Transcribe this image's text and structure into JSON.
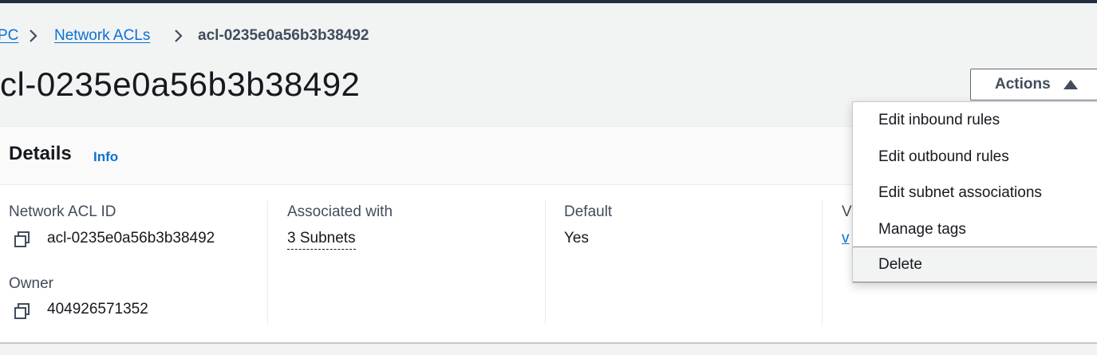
{
  "breadcrumb": {
    "vpc_label": "PC",
    "acls_label": "Network ACLs",
    "current": "acl-0235e0a56b3b38492"
  },
  "page": {
    "title": "cl-0235e0a56b3b38492"
  },
  "actions": {
    "label": "Actions"
  },
  "details": {
    "title": "Details",
    "info": "Info",
    "fields": {
      "acl_id": {
        "label": "Network ACL ID",
        "value": "acl-0235e0a56b3b38492"
      },
      "owner": {
        "label": "Owner",
        "value": "404926571352"
      },
      "associated": {
        "label": "Associated with",
        "value": "3 Subnets"
      },
      "default": {
        "label": "Default",
        "value": "Yes"
      },
      "vpc": {
        "label": "V",
        "value": "v"
      }
    }
  },
  "menu": {
    "items": [
      {
        "label": "Edit inbound rules"
      },
      {
        "label": "Edit outbound rules"
      },
      {
        "label": "Edit subnet associations"
      },
      {
        "label": "Manage tags"
      },
      {
        "label": "Delete"
      }
    ]
  },
  "icons": {
    "breadcrumb_separator": "chevron-right-icon",
    "copy": "copy-icon",
    "dropdown_open": "caret-up-icon"
  },
  "colors": {
    "link": "#0972d3",
    "top_bar": "#232f3e",
    "page_background": "#f2f3f3"
  }
}
